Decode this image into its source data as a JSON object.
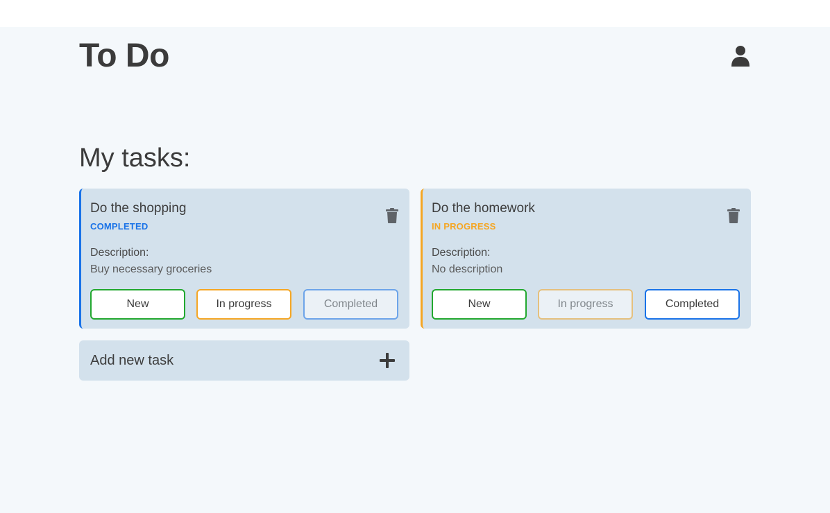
{
  "header": {
    "title": "To Do",
    "user_icon": "user-icon"
  },
  "main": {
    "section_title": "My tasks:",
    "tasks": [
      {
        "title": "Do the shopping",
        "status": "COMPLETED",
        "status_color": "#1a73e8",
        "description_label": "Description:",
        "description": "Buy necessary groceries",
        "buttons": {
          "new": "New",
          "in_progress": "In progress",
          "completed": "Completed"
        }
      },
      {
        "title": "Do the homework",
        "status": "IN PROGRESS",
        "status_color": "#f5a623",
        "description_label": "Description:",
        "description": "No description",
        "buttons": {
          "new": "New",
          "in_progress": "In progress",
          "completed": "Completed"
        }
      }
    ],
    "add_task": {
      "label": "Add new task",
      "icon": "plus-icon"
    }
  },
  "colors": {
    "new": "#22a82f",
    "in_progress": "#f5a623",
    "completed": "#1a73e8",
    "card_bg": "#d3e1ec",
    "page_bg": "#f4f8fb"
  }
}
